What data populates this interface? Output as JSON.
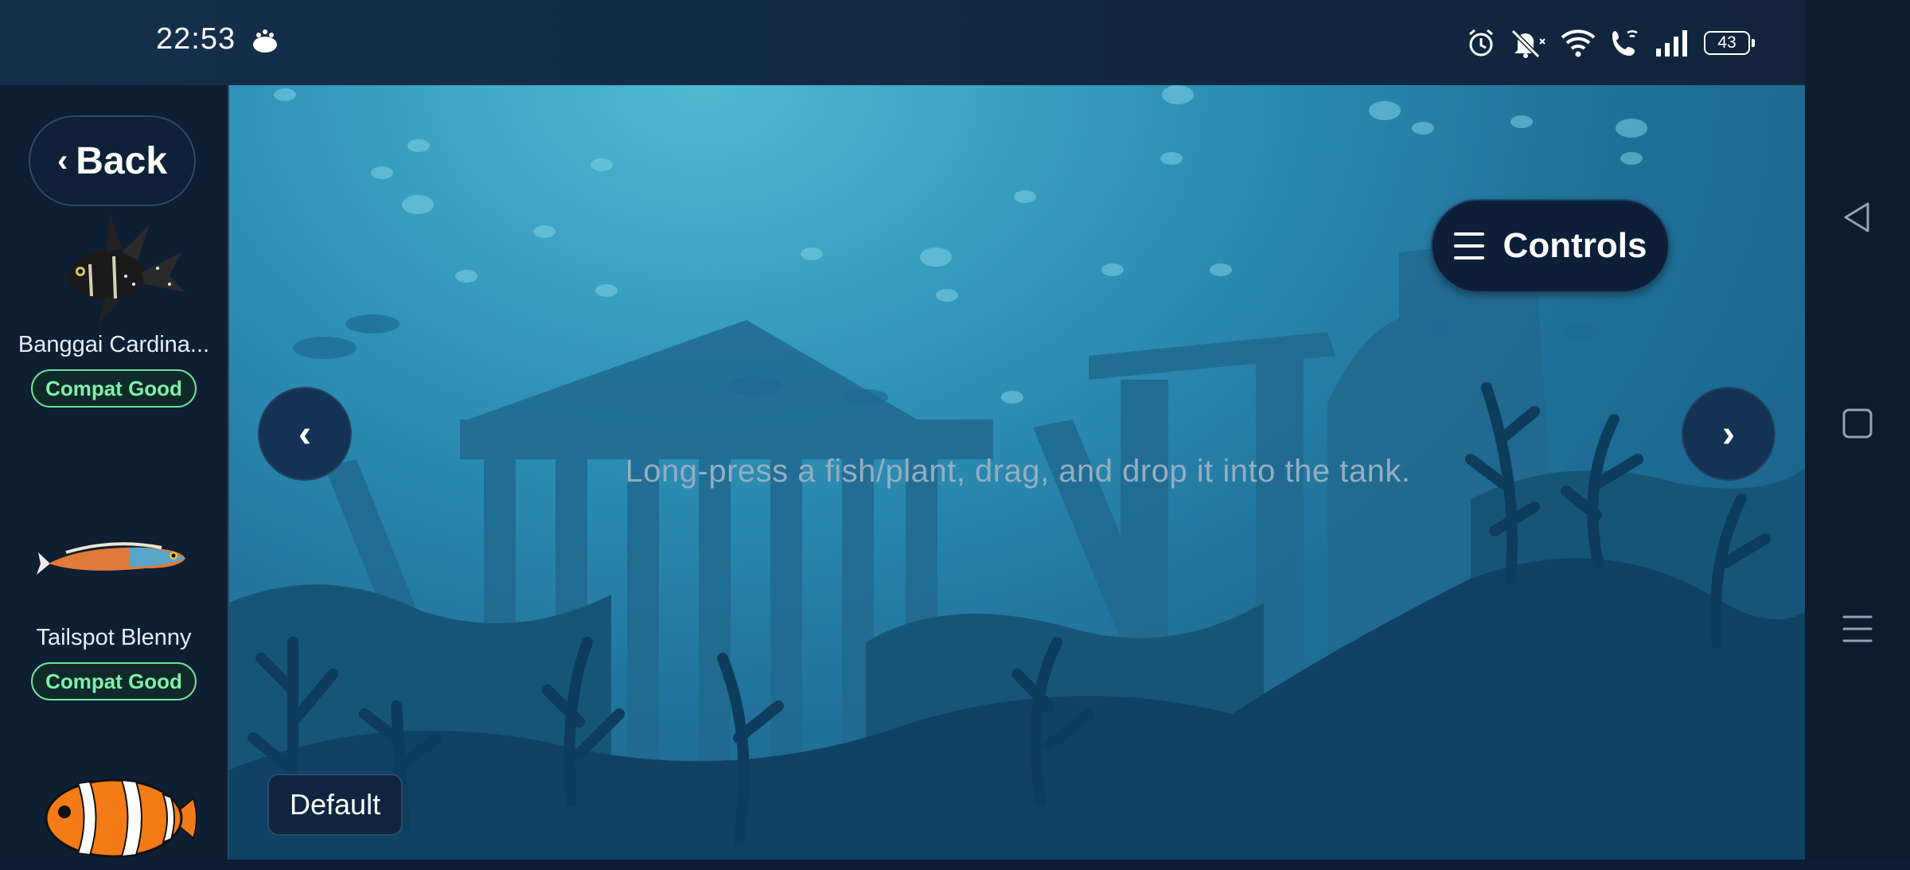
{
  "status_bar": {
    "time": "22:53",
    "battery": "43",
    "icons": [
      "cat-app-icon",
      "alarm-icon",
      "mute-icon",
      "wifi-icon",
      "wifi-call-icon",
      "signal-icon",
      "battery-icon"
    ]
  },
  "sidebar": {
    "back_label": "Back",
    "fish": [
      {
        "name": "Banggai Cardina...",
        "compat": "Compat Good",
        "icon": "banggai-cardinalfish-image"
      },
      {
        "name": "Tailspot Blenny",
        "compat": "Compat Good",
        "icon": "tailspot-blenny-image"
      },
      {
        "name": "",
        "compat": "",
        "icon": "clownfish-image"
      }
    ]
  },
  "tank": {
    "hint": "Long-press a fish/plant, drag, and drop it into the tank.",
    "controls_label": "Controls",
    "prev_label": "‹",
    "next_label": "›",
    "theme_label": "Default"
  },
  "colors": {
    "accent_green": "#7ff0ab",
    "panel": "#0e1e33",
    "water": "#2f93b8"
  }
}
